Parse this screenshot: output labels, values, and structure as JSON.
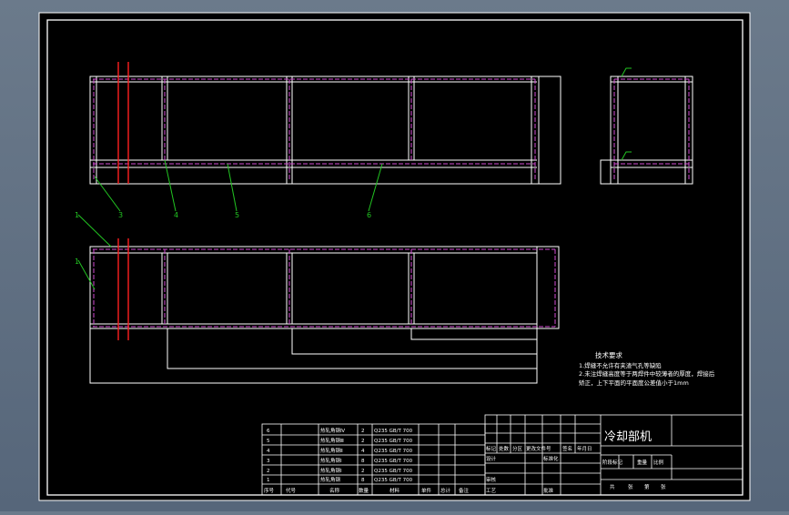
{
  "drawing": {
    "title": "冷却部机",
    "leaders": [
      "1",
      "1",
      "3",
      "4",
      "5",
      "6"
    ]
  },
  "tech_requirements": {
    "heading": "技术要求",
    "lines": [
      "1.焊缝不允许有夹渣气孔等缺陷",
      "2.未注焊缝高度等于两焊件中较薄者的厚度，焊接后",
      "   矫正，上下平面的平面度公差值小于1mm"
    ]
  },
  "bom": {
    "rows": [
      {
        "no": "6",
        "name": "热轧角钢Ⅳ",
        "qty": "2",
        "material": "Q235 GB/T 700"
      },
      {
        "no": "5",
        "name": "热轧角钢Ⅲ",
        "qty": "2",
        "material": "Q235 GB/T 700"
      },
      {
        "no": "4",
        "name": "热轧角钢Ⅱ",
        "qty": "4",
        "material": "Q235 GB/T 700"
      },
      {
        "no": "3",
        "name": "热轧角钢Ⅰ",
        "qty": "8",
        "material": "Q235 GB/T 700"
      },
      {
        "no": "2",
        "name": "热轧角钢Ⅰ",
        "qty": "2",
        "material": "Q235 GB/T 700"
      },
      {
        "no": "1",
        "name": "热轧角钢",
        "qty": "8",
        "material": "Q235 GB/T 700"
      }
    ],
    "headers": [
      "序号",
      "代号",
      "名称",
      "数量",
      "材料",
      "单件",
      "总计",
      "备注"
    ]
  },
  "title_block": {
    "cells": [
      "标记",
      "处数",
      "分区",
      "更改文件号",
      "签名",
      "年月日",
      "设计",
      "标准化",
      "审核",
      "工艺",
      "批准",
      "阶段标记",
      "重量",
      "比例",
      "共",
      "张",
      "第",
      "张"
    ]
  },
  "colors": {
    "sheet": "#000000",
    "line": "#ffffff",
    "hidden": "#d34bd3",
    "section": "#ff2020",
    "leader": "#22c522"
  }
}
